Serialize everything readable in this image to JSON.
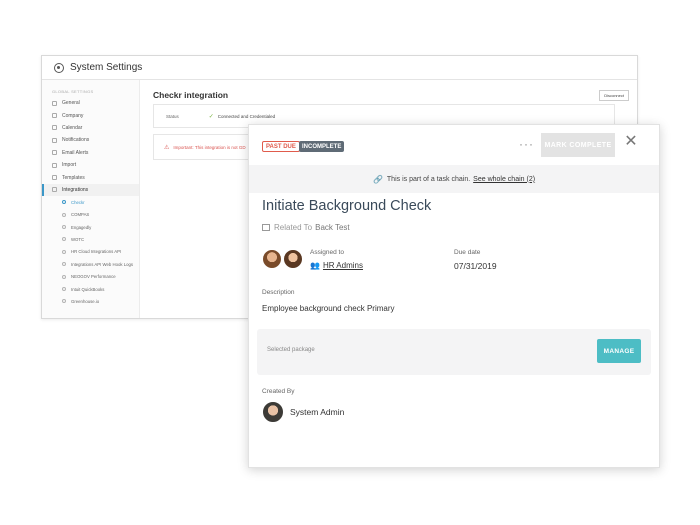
{
  "settings": {
    "title": "System Settings",
    "group_label": "GLOBAL SETTINGS",
    "nav": [
      {
        "label": "General"
      },
      {
        "label": "Company"
      },
      {
        "label": "Calendar"
      },
      {
        "label": "Notifications"
      },
      {
        "label": "Email Alerts"
      },
      {
        "label": "Import"
      },
      {
        "label": "Templates"
      },
      {
        "label": "Integrations"
      }
    ],
    "integrations": [
      {
        "label": "Checkr"
      },
      {
        "label": "COMPAS"
      },
      {
        "label": "Engagedly"
      },
      {
        "label": "WOTC"
      },
      {
        "label": "HR Cloud Integrations API"
      },
      {
        "label": "Integrations API Web Hook Logs"
      },
      {
        "label": "NEOGOV Performance"
      },
      {
        "label": "Intuit QuickBooks"
      },
      {
        "label": "Greenhouse.io"
      }
    ],
    "main_title": "Checkr integration",
    "disconnect_label": "Disconnect",
    "status_label": "Status",
    "status_value": "Connected and Credentialed",
    "warning_text": "Important: This integration is not GD"
  },
  "task": {
    "badge_past_due": "PAST DUE",
    "badge_incomplete": "INCOMPLETE",
    "more_label": "···",
    "mark_complete_label": "MARK COMPLETE",
    "close_label": "✕",
    "chain_text": "This is part of a task chain.",
    "chain_link": "See whole chain (2)",
    "title": "Initiate Background Check",
    "related_to_label": "Related To",
    "related_to_value": "Back Test",
    "assigned_label": "Assigned to",
    "assigned_value": "HR Admins",
    "due_label": "Due date",
    "due_value": "07/31/2019",
    "description_label": "Description",
    "description_value": "Employee background check Primary",
    "package_label": "Selected package",
    "manage_label": "MANAGE",
    "created_by_label": "Created By",
    "created_by_value": "System Admin"
  },
  "colors": {
    "accent_teal": "#4dbdc5",
    "past_due_red": "#e05b4c",
    "incomplete_gray": "#5f6b76",
    "sidebar_active": "#3b97c8"
  }
}
